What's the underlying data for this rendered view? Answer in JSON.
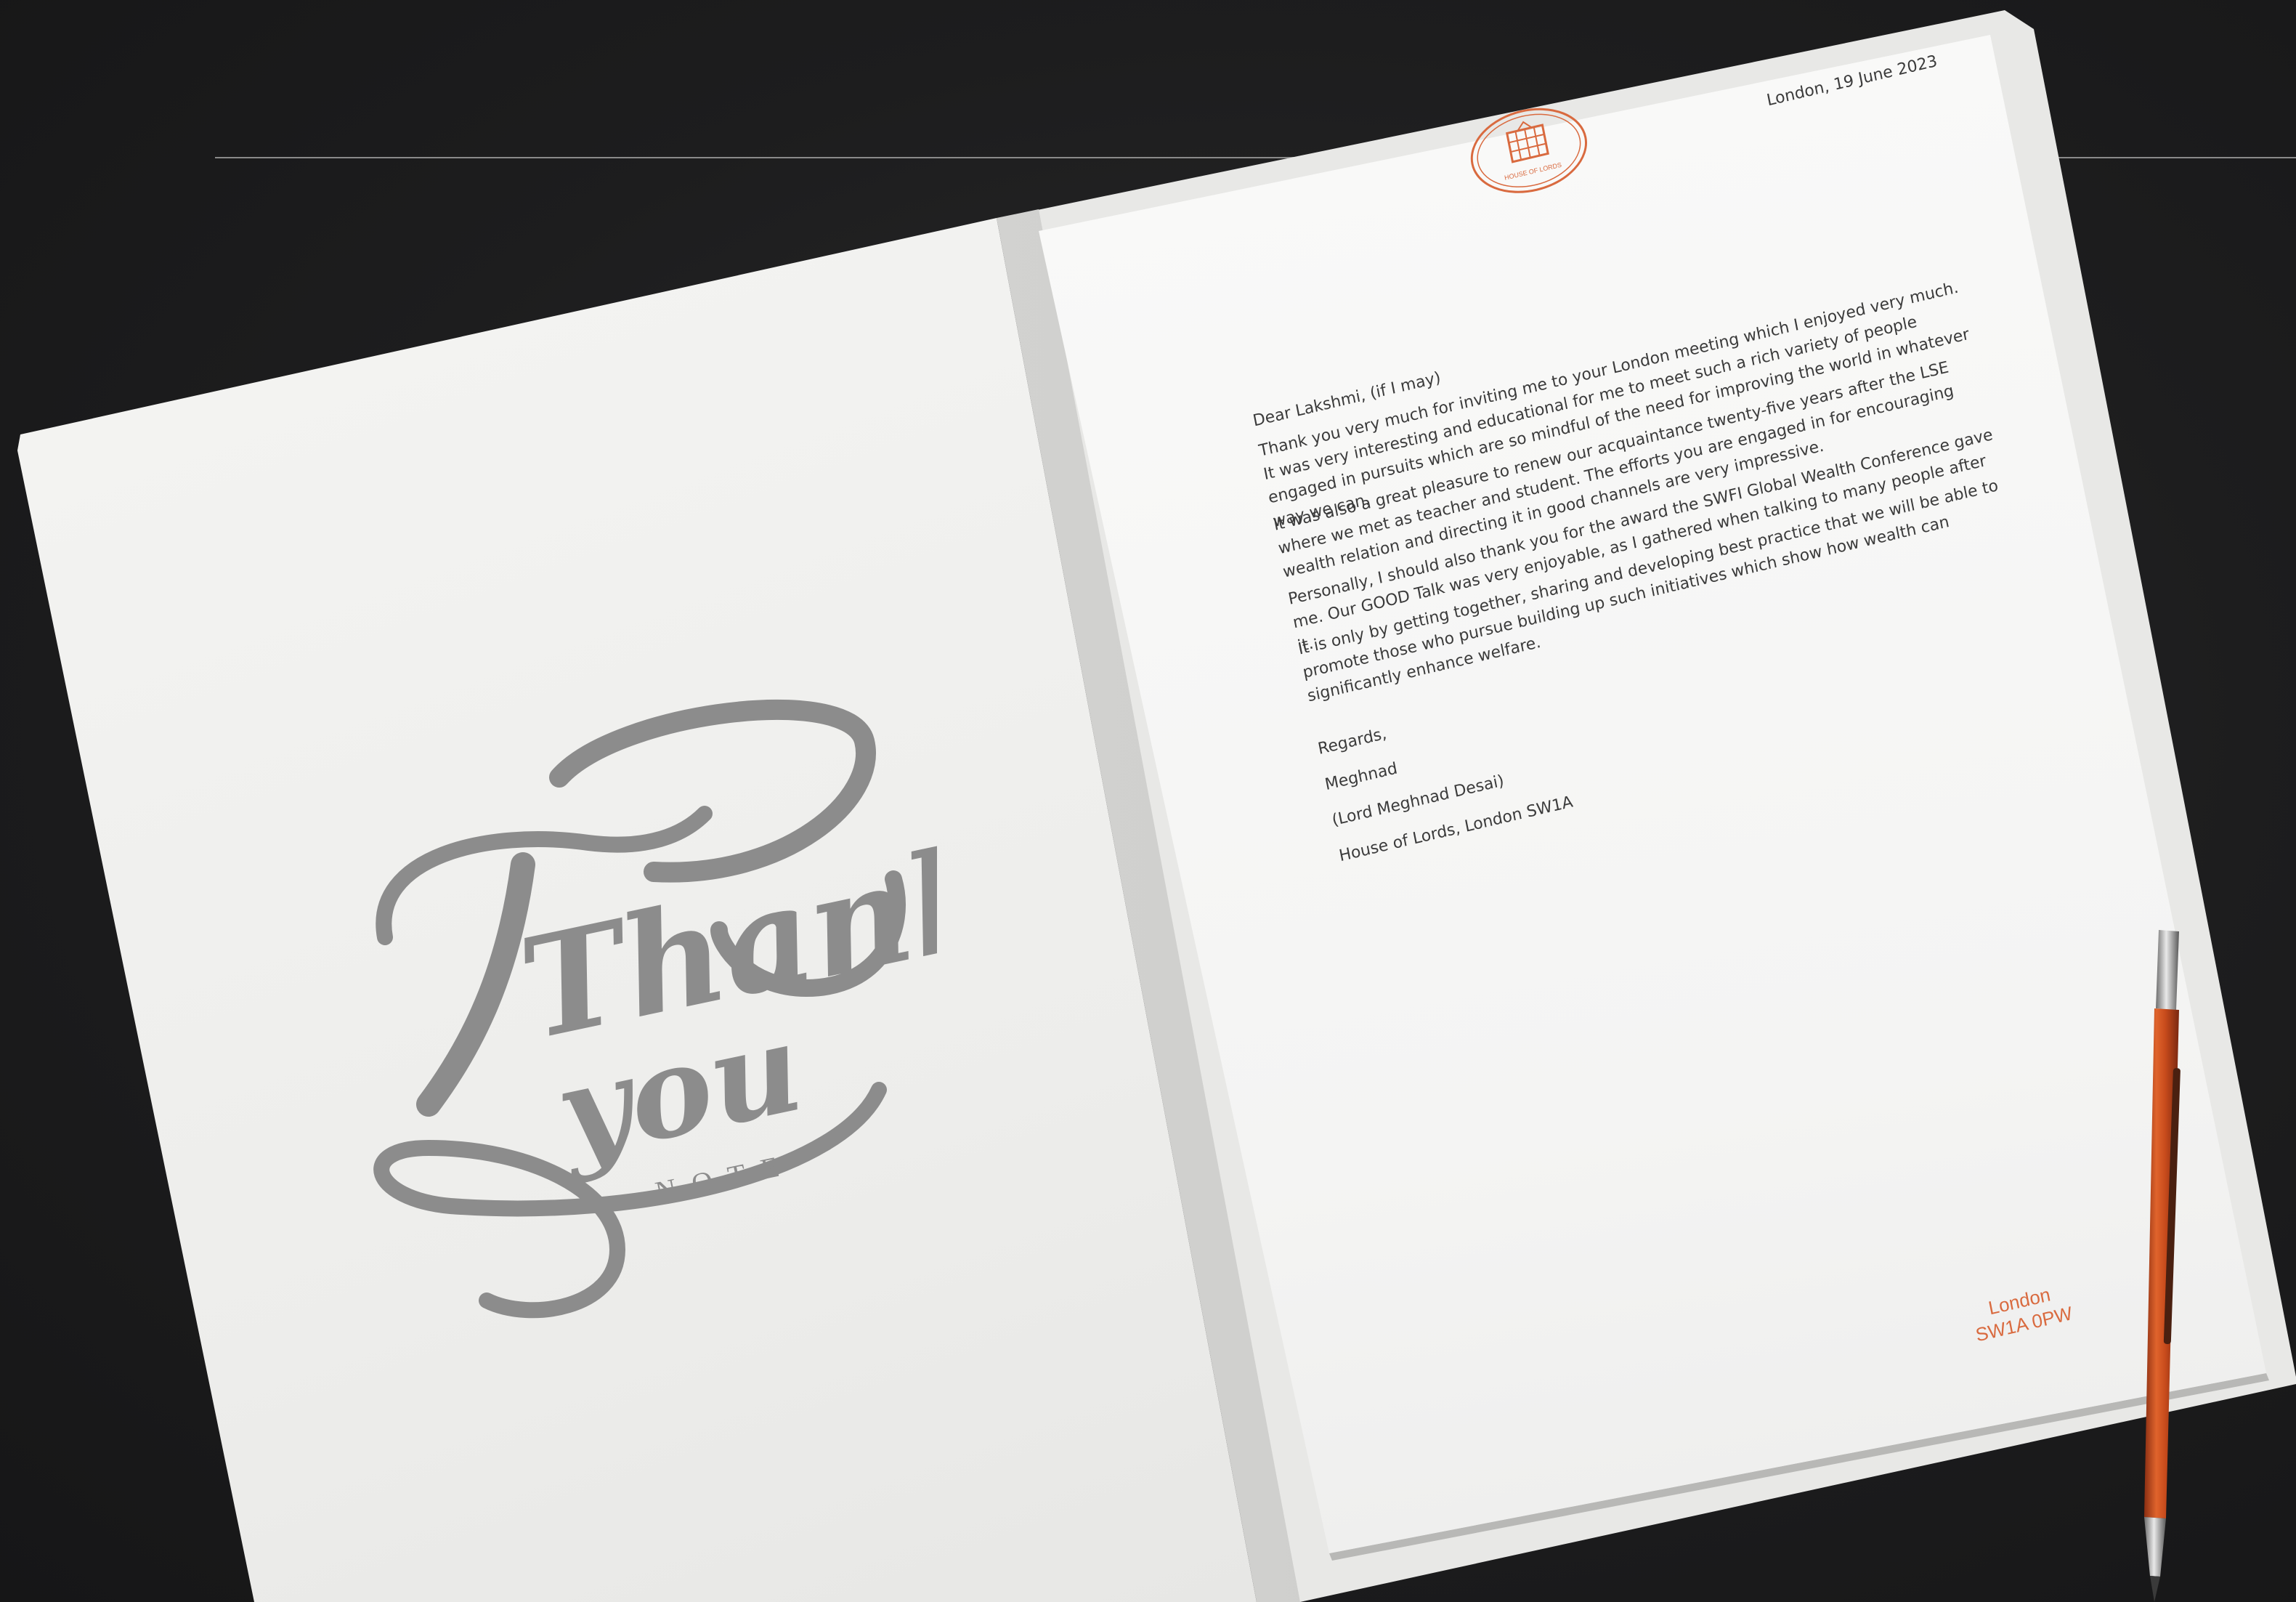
{
  "card": {
    "script_line1": "Thank",
    "script_line2": "you",
    "script_line3": "NOTE"
  },
  "letter": {
    "seal_text": "HOUSE OF LORDS",
    "date": "London, 19 June 2023",
    "salutation": "Dear Lakshmi, (if I may)",
    "paragraphs": [
      "Thank you very much for inviting me to your London meeting which I enjoyed very much. It was very interesting and educational for me to meet such a rich variety of people engaged in pursuits which are so mindful of the need for improving the world in whatever way we can.",
      "It was also a great pleasure to renew our acquaintance twenty-five years after the LSE where we met as teacher and student. The efforts you are engaged in for encouraging wealth relation and directing it in good channels are very impressive.",
      "Personally, I should also thank you for the award the SWFI Global Wealth Conference gave me. Our GOOD Talk was very enjoyable, as I gathered when talking to many people after it.",
      "It is only by getting together, sharing and developing best practice that we will be able to promote those who pursue building up such initiatives which show how wealth can significantly enhance welfare."
    ],
    "closing": "Regards,",
    "signature_name": "Meghnad",
    "signature_title": "(Lord Meghnad Desai)",
    "signature_address": "House of Lords, London SW1A",
    "footer_line1": "London",
    "footer_line2": "SW1A 0PW"
  },
  "colors": {
    "background": "#1d1d1e",
    "accent": "#d96a3f",
    "script": "#8c8c8c"
  }
}
